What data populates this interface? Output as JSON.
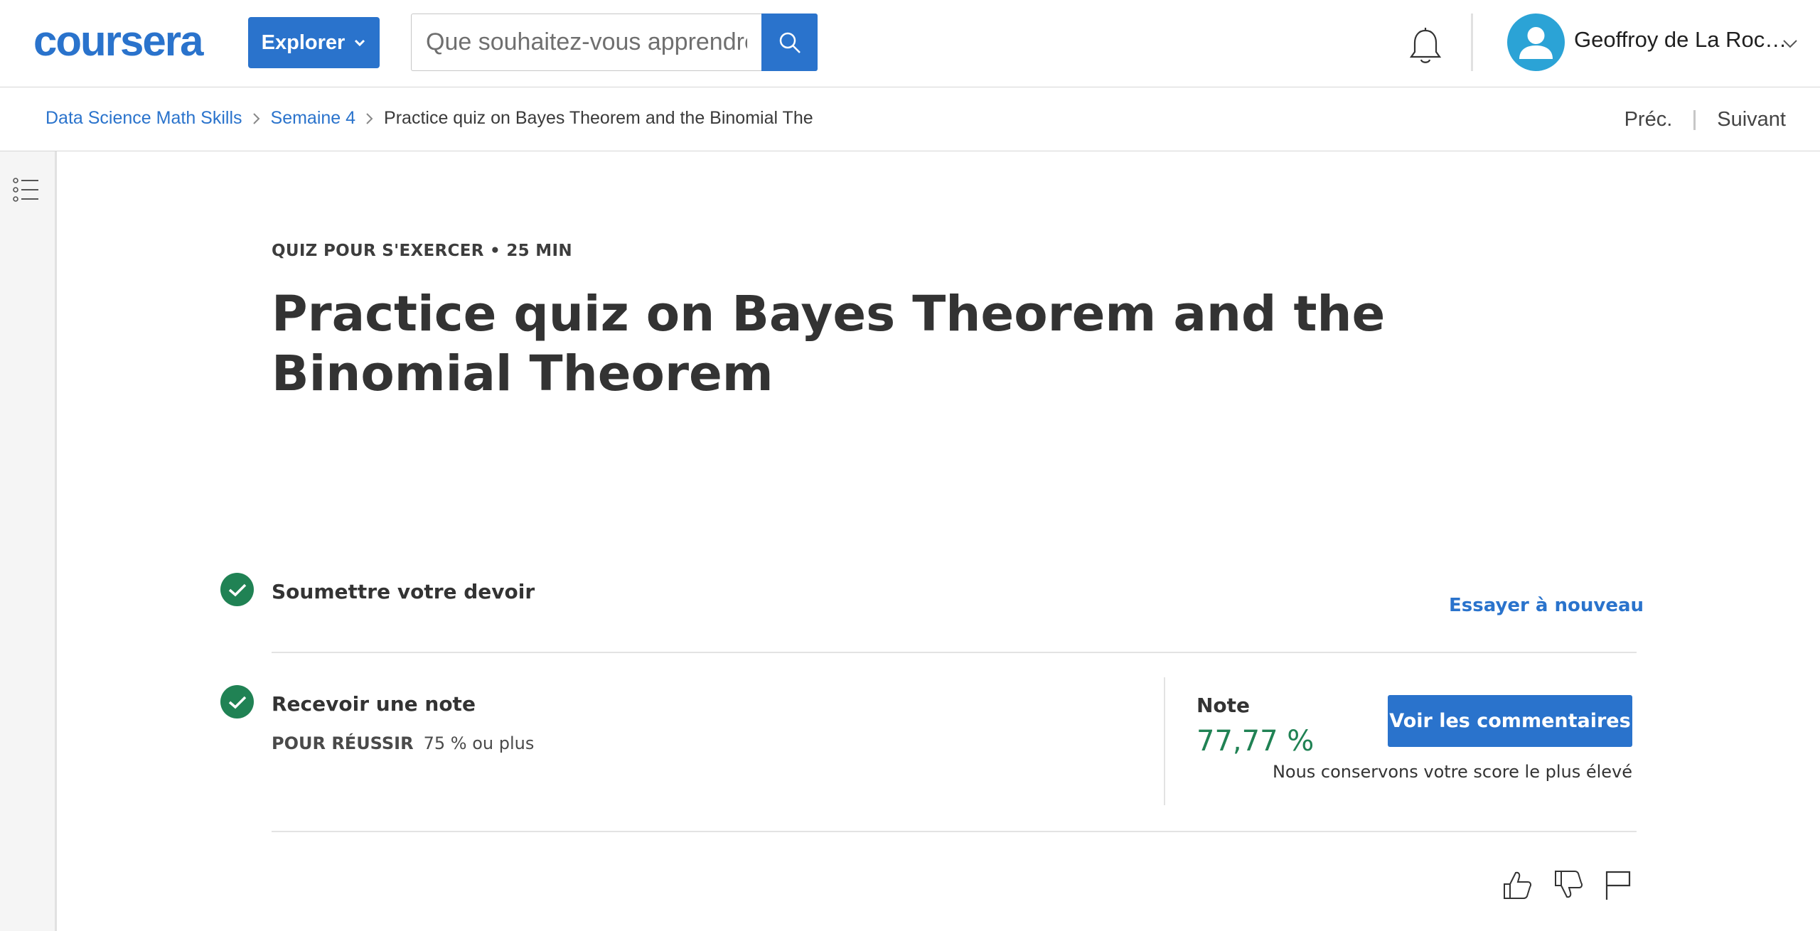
{
  "header": {
    "logo_text": "coursera",
    "explore_label": "Explorer",
    "search_placeholder": "Que souhaitez-vous apprendre",
    "user_name": "Geoffroy de La Roc…",
    "brand_color": "#2a73cc"
  },
  "breadcrumb": {
    "items": [
      "Data Science Math Skills",
      "Semaine 4"
    ],
    "current": "Practice quiz on Bayes Theorem and the Binomial The",
    "prev_label": "Préc.",
    "next_label": "Suivant"
  },
  "quiz": {
    "kicker": "QUIZ POUR S'EXERCER • 25  MIN",
    "title": "Practice quiz on Bayes Theorem and the Binomial Theorem"
  },
  "submit_step": {
    "title": "Soumettre votre devoir",
    "retry_label": "Essayer à nouveau"
  },
  "grade_step": {
    "title": "Recevoir une note",
    "pass_label": "POUR RÉUSSIR",
    "pass_value": "75 % ou plus",
    "grade_label": "Note",
    "grade_value": "77,77 %",
    "feedback_button": "Voir les commentaires",
    "keep_note": "Nous conservons votre score le plus élevé",
    "success_color": "#208254"
  },
  "icons": [
    "search-icon",
    "bell-icon",
    "user-icon",
    "chevron-down-icon",
    "chevron-right-icon",
    "list-icon",
    "check-icon",
    "thumbs-up-icon",
    "thumbs-down-icon",
    "flag-icon"
  ]
}
